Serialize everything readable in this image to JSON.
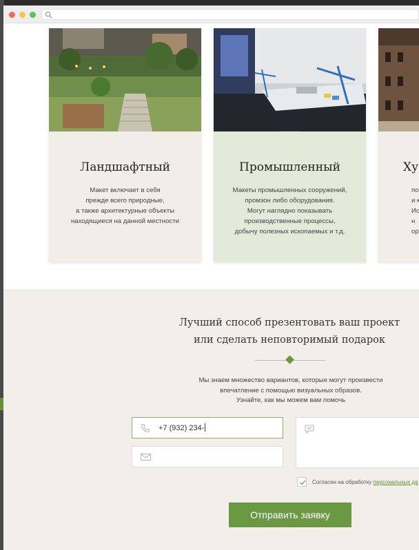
{
  "browser": {
    "address_text": ""
  },
  "cards": [
    {
      "title": "Ландшафтный",
      "text": [
        "Макет включает в себя",
        "прежде всего природные,",
        "а также архитектурные объекты",
        "находящиеся на данной местности"
      ]
    },
    {
      "title": "Промышленный",
      "text": [
        "Макеты промышленных сооружений,",
        "промзон либо оборудования.",
        "Могут наглядно показывать",
        "производственные процессы,",
        "добычу полезных ископаемых и т.д."
      ]
    },
    {
      "title": "Ху",
      "text": [
        "по",
        "и к",
        "Испо",
        "н",
        "ор"
      ]
    }
  ],
  "cta": {
    "headline_line1": "Лучший способ презентовать ваш проект",
    "headline_line2": "или сделать неповторимый подарок",
    "desc_line1": "Мы знаем множество вариантов, которые могут произвести",
    "desc_line2": "впечатление с помощью визуальных образов.",
    "desc_line3": "Узнайте, как мы можем вам помочь"
  },
  "form": {
    "phone_value": "+7 (932) 234-",
    "email_value": "",
    "comment_value": "",
    "agree_text": "Согласен на обработку",
    "agree_link": "персональных да",
    "submit_label": "Отправить заявку"
  },
  "colors": {
    "accent_green": "#6a9843",
    "card_beige": "#f1eee9",
    "card_green": "#e3ead9"
  },
  "icons": [
    "search-icon",
    "phone-icon",
    "mail-icon",
    "comment-icon",
    "check-icon"
  ]
}
